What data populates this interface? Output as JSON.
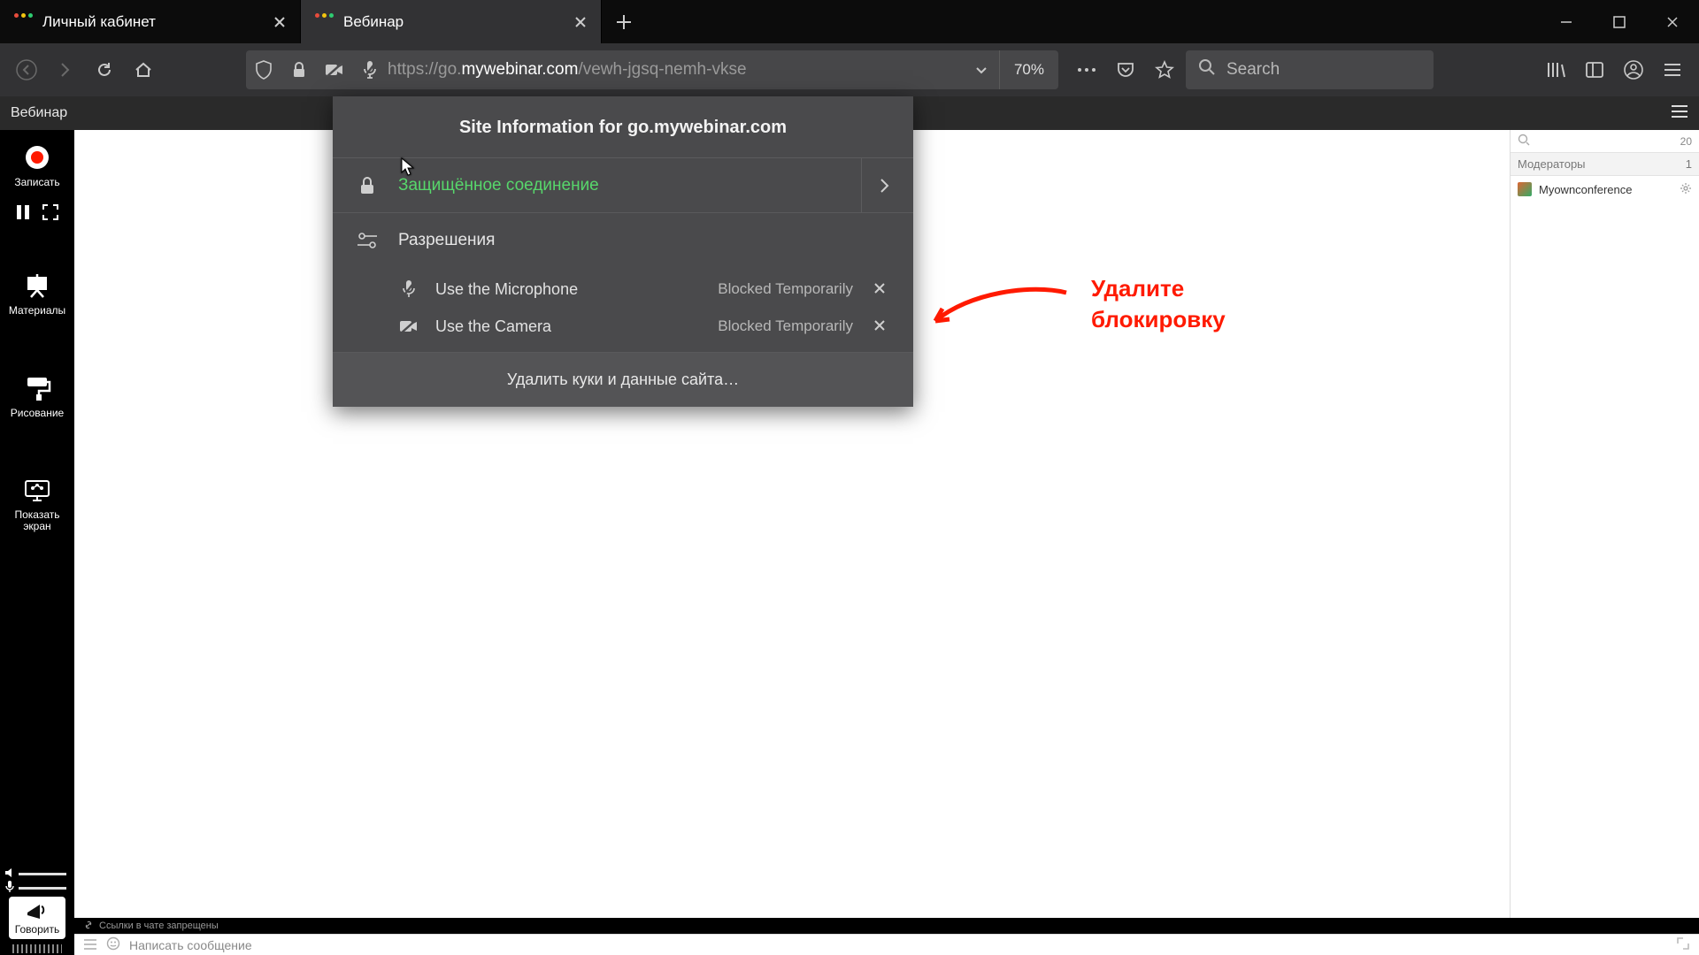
{
  "tabs": [
    {
      "title": "Личный кабинет"
    },
    {
      "title": "Вебинар"
    }
  ],
  "url": {
    "proto": "https://go.",
    "host": "mywebinar.com",
    "path": "/vewh-jgsq-nemh-vkse"
  },
  "zoom": "70%",
  "search_placeholder": "Search",
  "webinar_header": "Вебинар",
  "left_tools": {
    "record": "Записать",
    "materials": "Материалы",
    "drawing": "Рисование",
    "share": "Показать экран",
    "talk": "Говорить"
  },
  "participants": {
    "total": "20",
    "moderators_label": "Модераторы",
    "moderators_count": "1",
    "item": "Myownconference"
  },
  "chat": {
    "warn": "Ссылки в чате запрещены",
    "placeholder": "Написать сообщение"
  },
  "popover": {
    "title": "Site Information for go.mywebinar.com",
    "secure": "Защищённое соединение",
    "perms_label": "Разрешения",
    "mic": "Use the Microphone",
    "cam": "Use the Camera",
    "blocked": "Blocked Temporarily",
    "clear": "Удалить куки и данные сайта…"
  },
  "annotation": "Удалите блокировку"
}
